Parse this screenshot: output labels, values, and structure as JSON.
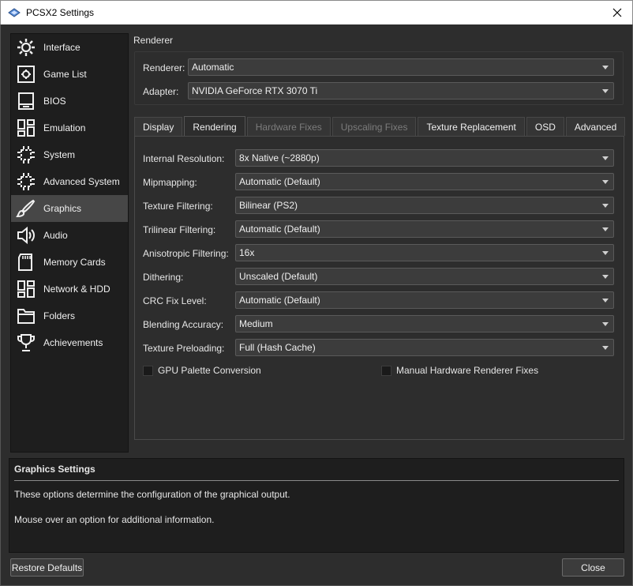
{
  "window": {
    "title": "PCSX2 Settings"
  },
  "sidebar": {
    "items": [
      {
        "label": "Interface",
        "icon": "interface-icon"
      },
      {
        "label": "Game List",
        "icon": "game-list-icon"
      },
      {
        "label": "BIOS",
        "icon": "bios-icon"
      },
      {
        "label": "Emulation",
        "icon": "emulation-icon"
      },
      {
        "label": "System",
        "icon": "chip-icon"
      },
      {
        "label": "Advanced System",
        "icon": "chip-icon"
      },
      {
        "label": "Graphics",
        "icon": "brush-icon",
        "active": true
      },
      {
        "label": "Audio",
        "icon": "speaker-icon"
      },
      {
        "label": "Memory Cards",
        "icon": "memory-card-icon"
      },
      {
        "label": "Network & HDD",
        "icon": "network-icon"
      },
      {
        "label": "Folders",
        "icon": "folder-icon"
      },
      {
        "label": "Achievements",
        "icon": "trophy-icon"
      }
    ]
  },
  "renderer": {
    "section_label": "Renderer",
    "renderer_label": "Renderer:",
    "renderer_value": "Automatic",
    "adapter_label": "Adapter:",
    "adapter_value": "NVIDIA GeForce RTX 3070 Ti"
  },
  "tabs": [
    {
      "label": "Display",
      "state": "normal"
    },
    {
      "label": "Rendering",
      "state": "active"
    },
    {
      "label": "Hardware Fixes",
      "state": "disabled"
    },
    {
      "label": "Upscaling Fixes",
      "state": "disabled"
    },
    {
      "label": "Texture Replacement",
      "state": "normal"
    },
    {
      "label": "OSD",
      "state": "normal"
    },
    {
      "label": "Advanced",
      "state": "normal"
    }
  ],
  "rendering": {
    "rows": [
      {
        "label": "Internal Resolution:",
        "value": "8x Native (~2880p)"
      },
      {
        "label": "Mipmapping:",
        "value": "Automatic (Default)"
      },
      {
        "label": "Texture Filtering:",
        "value": "Bilinear (PS2)"
      },
      {
        "label": "Trilinear Filtering:",
        "value": "Automatic (Default)"
      },
      {
        "label": "Anisotropic Filtering:",
        "value": "16x"
      },
      {
        "label": "Dithering:",
        "value": "Unscaled (Default)"
      },
      {
        "label": "CRC Fix Level:",
        "value": "Automatic (Default)"
      },
      {
        "label": "Blending Accuracy:",
        "value": "Medium"
      },
      {
        "label": "Texture Preloading:",
        "value": "Full (Hash Cache)"
      }
    ],
    "checkboxes": [
      {
        "label": "GPU Palette Conversion",
        "checked": false
      },
      {
        "label": "Manual Hardware Renderer Fixes",
        "checked": false
      }
    ]
  },
  "info": {
    "heading": "Graphics Settings",
    "line1": "These options determine the configuration of the graphical output.",
    "line2": "Mouse over an option for additional information."
  },
  "buttons": {
    "restore_defaults": "Restore Defaults",
    "close": "Close"
  }
}
